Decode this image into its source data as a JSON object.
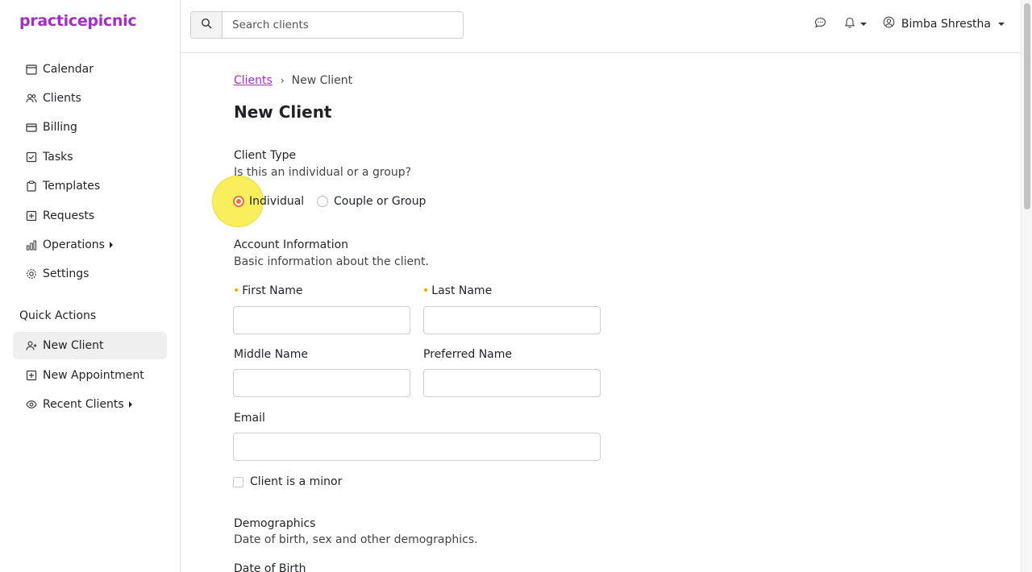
{
  "app": {
    "logo": "practicepicnic",
    "brand_color": "#a52cc6"
  },
  "sidebar": {
    "items": [
      {
        "label": "Calendar",
        "icon": "calendar-icon"
      },
      {
        "label": "Clients",
        "icon": "users-icon"
      },
      {
        "label": "Billing",
        "icon": "credit-card-icon"
      },
      {
        "label": "Tasks",
        "icon": "checkbox-icon"
      },
      {
        "label": "Templates",
        "icon": "clipboard-icon"
      },
      {
        "label": "Requests",
        "icon": "plus-square-icon"
      },
      {
        "label": "Operations",
        "icon": "bar-chart-icon"
      },
      {
        "label": "Settings",
        "icon": "gear-icon"
      }
    ],
    "quick_actions_title": "Quick Actions",
    "quick_actions": [
      {
        "label": "New Client",
        "icon": "user-plus-icon",
        "active": true
      },
      {
        "label": "New Appointment",
        "icon": "plus-square-icon"
      },
      {
        "label": "Recent Clients",
        "icon": "eye-icon"
      }
    ]
  },
  "topbar": {
    "search_placeholder": "Search clients",
    "user_name": "Bimba Shrestha"
  },
  "breadcrumb": {
    "link": "Clients",
    "separator": "›",
    "current": "New Client"
  },
  "page_title": "New Client",
  "client_type": {
    "heading": "Client Type",
    "description": "Is this an individual or a group?",
    "options": [
      "Individual",
      "Couple or Group"
    ],
    "selected": "Individual"
  },
  "account": {
    "heading": "Account Information",
    "description": "Basic information about the client.",
    "first_name_label": "First Name",
    "last_name_label": "Last Name",
    "middle_name_label": "Middle Name",
    "preferred_name_label": "Preferred Name",
    "email_label": "Email",
    "minor_label": "Client is a minor"
  },
  "demographics": {
    "heading": "Demographics",
    "description": "Date of birth, sex and other demographics.",
    "dob_label": "Date of Birth"
  },
  "colors": {
    "radio_selected": "#e8743b",
    "required": "#f0a500",
    "highlight": "#f8e81e"
  }
}
